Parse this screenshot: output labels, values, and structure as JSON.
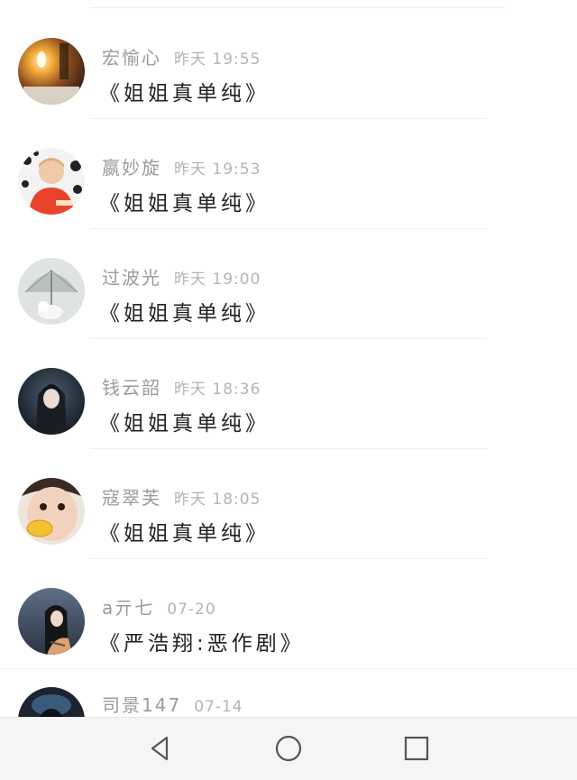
{
  "comments": [
    {
      "user": "宏愉心",
      "time": "昨天 19:55",
      "text": "《姐姐真单纯》",
      "avatar_icon": "candle-photo-avatar"
    },
    {
      "user": "嬴妙旋",
      "time": "昨天 19:53",
      "text": "《姐姐真单纯》",
      "avatar_icon": "child-red-shirt-avatar"
    },
    {
      "user": "过波光",
      "time": "昨天 19:00",
      "text": "《姐姐真单纯》",
      "avatar_icon": "umbrella-photo-avatar"
    },
    {
      "user": "钱云韶",
      "time": "昨天 18:36",
      "text": "《姐姐真单纯》",
      "avatar_icon": "anime-girl-avatar"
    },
    {
      "user": "寇翠芙",
      "time": "昨天 18:05",
      "text": "《姐姐真单纯》",
      "avatar_icon": "baby-corn-avatar"
    },
    {
      "user": "a亓七",
      "time": "07-20",
      "text": "《严浩翔:恶作剧》",
      "avatar_icon": "girl-black-hair-avatar"
    },
    {
      "user": "司景147",
      "time": "07-14",
      "text": "",
      "avatar_icon": "dark-photo-avatar"
    }
  ],
  "navbar": {
    "back_icon": "back-triangle-icon",
    "home_icon": "home-circle-icon",
    "recents_icon": "recents-square-icon"
  },
  "colors": {
    "username": "#9b9b9b",
    "timestamp": "#b4b4b4",
    "content": "#222222",
    "navbar_bg": "#f5f5f5",
    "nav_icon": "#555555"
  }
}
